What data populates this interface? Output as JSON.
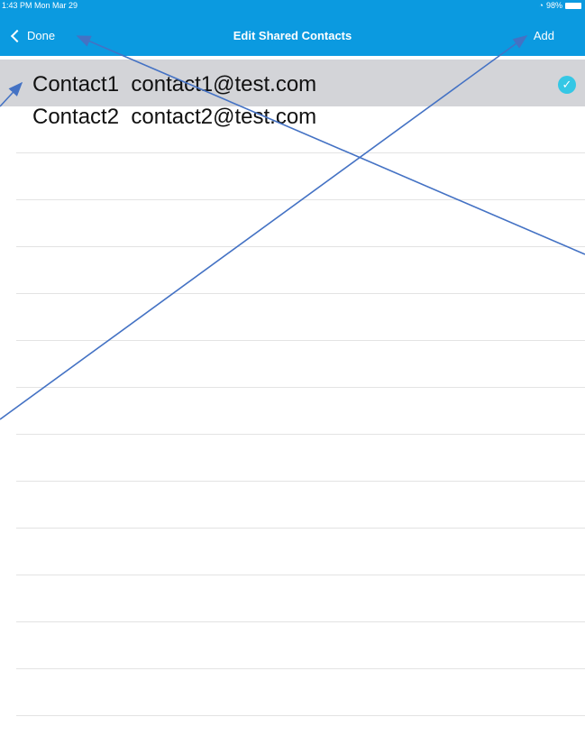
{
  "status_bar": {
    "time": "1:43 PM  Mon Mar 29",
    "battery": "98%"
  },
  "nav": {
    "back_label": "Done",
    "title": "Edit Shared Contacts",
    "add_label": "Add"
  },
  "contacts": [
    {
      "text": "Contact1  contact1@test.com",
      "selected": true
    },
    {
      "text": "Contact2  contact2@test.com",
      "selected": false
    }
  ],
  "colors": {
    "nav_bg": "#0b9ae0",
    "selected_row": "#d3d4d8",
    "check": "#35c7e5",
    "annotation": "#4472c4"
  }
}
